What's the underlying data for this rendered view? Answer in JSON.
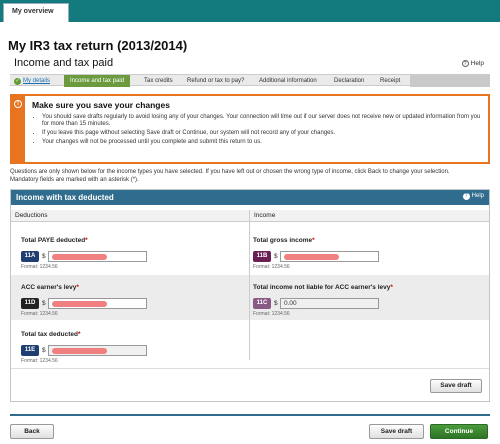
{
  "topbar": {
    "tab_label": "My overview"
  },
  "page": {
    "title": "My IR3 tax return (2013/2014)",
    "subtitle": "Income and tax paid",
    "help_label": "Help"
  },
  "steps": [
    {
      "label": "My details",
      "state": "done"
    },
    {
      "label": "Income and tax paid",
      "state": "current"
    },
    {
      "label": "Tax credits",
      "state": "todo"
    },
    {
      "label": "Refund or tax to pay?",
      "state": "todo"
    },
    {
      "label": "Additional information",
      "state": "todo"
    },
    {
      "label": "Declaration",
      "state": "todo"
    },
    {
      "label": "Receipt",
      "state": "todo"
    }
  ],
  "warning": {
    "title": "Make sure you save your changes",
    "items": [
      "You should save drafts regularly to avoid losing any of your changes. Your connection will time out if our server does not receive new or updated information from you for more than 15 minutes.",
      "If you leave this page without selecting Save draft or Continue, our system will not record any of your changes.",
      "Your changes will not be processed until you complete and submit this return to us."
    ]
  },
  "intro": {
    "line1": "Questions are only shown below for the income types you have selected. If you have left out or chosen the wrong type of income, click Back to change your selection.",
    "line2": "Mandatory fields are marked with an asterisk (*)."
  },
  "panel": {
    "title": "Income with tax deducted",
    "help_label": "Help",
    "col_deductions": "Deductions",
    "col_income": "Income",
    "fields": {
      "paye": {
        "label": "Total PAYE deducted",
        "code": "11A",
        "currency": "$",
        "format": "Format: 1234.56"
      },
      "gross": {
        "label": "Total gross income",
        "code": "11B",
        "currency": "$",
        "format": "Format: 1234.56"
      },
      "acc": {
        "label": "ACC earner's levy",
        "code": "11D",
        "currency": "$",
        "format": "Format: 1234.56"
      },
      "not_liable": {
        "label": "Total income not liable for ACC earner's levy",
        "code": "11C",
        "currency": "$",
        "value": "0.00",
        "format": "Format: 1234.56"
      },
      "total_tax": {
        "label": "Total tax deducted",
        "code": "11E",
        "currency": "$",
        "format": "Format: 1234.56"
      }
    },
    "save_draft_label": "Save draft"
  },
  "footer": {
    "back_label": "Back",
    "save_draft_label": "Save draft",
    "continue_label": "Continue"
  },
  "colors": {
    "teal": "#137a7d",
    "panel_blue": "#2f6c8d",
    "orange": "#e8741f",
    "green": "#2e7428",
    "code_purple": "#6a1f55",
    "code_navy": "#1f3f73",
    "code_dark": "#222222",
    "code_mauve": "#8a5a86"
  }
}
